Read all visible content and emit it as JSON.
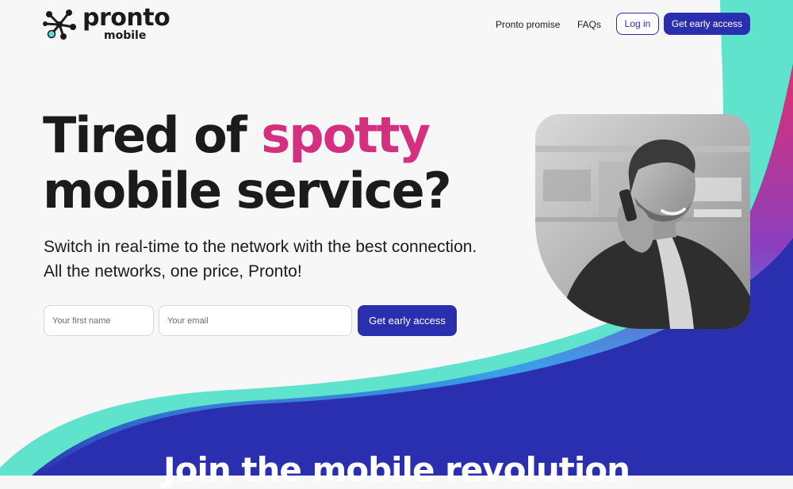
{
  "brand": {
    "name": "pronto",
    "sub": "mobile",
    "logo_icon": "network-nodes-icon"
  },
  "nav": {
    "links": [
      {
        "label": "Pronto promise"
      },
      {
        "label": "FAQs"
      }
    ],
    "login_label": "Log in",
    "cta_label": "Get early access"
  },
  "hero": {
    "title_part1": "Tired of ",
    "title_accent": "spotty",
    "title_part2": "mobile service?",
    "subtitle_line1": "Switch in real-time to the network with the best connection.",
    "subtitle_line2": "All the networks, one price, Pronto!",
    "photo_icon": "person-on-phone-photo"
  },
  "form": {
    "first_name_placeholder": "Your first name",
    "email_placeholder": "Your email",
    "submit_label": "Get early access"
  },
  "section": {
    "heading": "Join the mobile revolution"
  },
  "colors": {
    "primary": "#2a2fb0",
    "accent": "#d4307f",
    "teal": "#5fe3cc",
    "text": "#1b1b1b",
    "background": "#f7f7f8"
  }
}
